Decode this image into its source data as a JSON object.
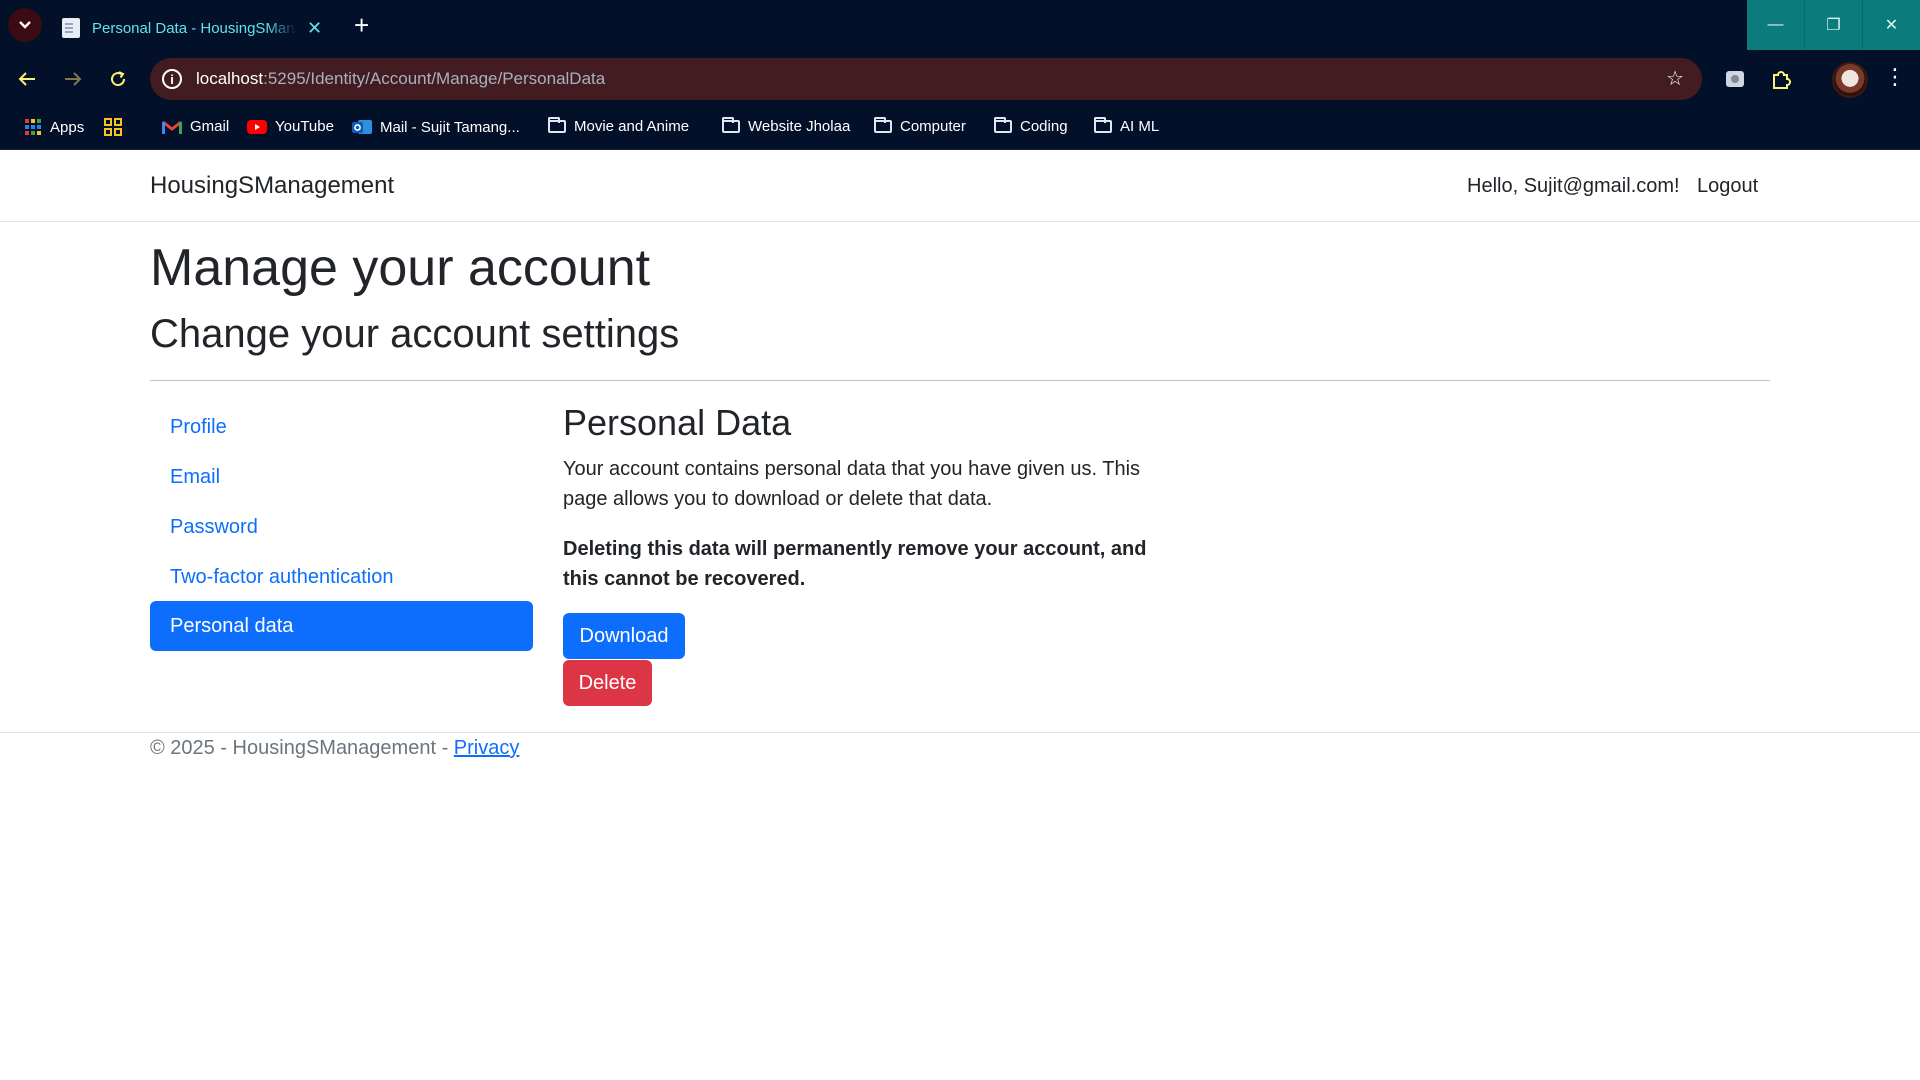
{
  "browser": {
    "tab": {
      "title": "Personal Data - HousingSManagement",
      "close_icon": "close-icon"
    },
    "url": {
      "host": "localhost",
      "path": ":5295/Identity/Account/Manage/PersonalData"
    },
    "bookmarks": [
      {
        "label": "Apps",
        "icon": "apps-grid-icon"
      },
      {
        "label": "",
        "icon": "tab-groups-icon"
      },
      {
        "label": "Gmail",
        "icon": "gmail-icon"
      },
      {
        "label": "YouTube",
        "icon": "youtube-icon"
      },
      {
        "label": "Mail - Sujit Tamang...",
        "icon": "outlook-icon"
      },
      {
        "label": "Movie and Anime",
        "icon": "folder-icon"
      },
      {
        "label": "Website Jholaa",
        "icon": "folder-icon"
      },
      {
        "label": "Computer",
        "icon": "folder-icon"
      },
      {
        "label": "Coding",
        "icon": "folder-icon"
      },
      {
        "label": "AI ML",
        "icon": "folder-icon"
      }
    ],
    "colors": {
      "chrome_bg": "#03102a",
      "omnibox_bg": "#421c20",
      "tab_text": "#5fe3f0",
      "window_controls": "#0b7b7b"
    }
  },
  "site": {
    "brand": "HousingSManagement",
    "greeting": "Hello, Sujit@gmail.com!",
    "logout": "Logout"
  },
  "page": {
    "heading": "Manage your account",
    "subheading": "Change your account settings",
    "sidebar": [
      {
        "label": "Profile",
        "active": false
      },
      {
        "label": "Email",
        "active": false
      },
      {
        "label": "Password",
        "active": false
      },
      {
        "label": "Two-factor authentication",
        "active": false
      },
      {
        "label": "Personal data",
        "active": true
      }
    ],
    "section_title": "Personal Data",
    "description": "Your account contains personal data that you have given us. This page allows you to download or delete that data.",
    "warning": "Deleting this data will permanently remove your account, and this cannot be recovered.",
    "download_label": "Download",
    "delete_label": "Delete"
  },
  "footer": {
    "text": "© 2025 - HousingSManagement - ",
    "privacy_link": "Privacy"
  },
  "colors": {
    "primary": "#0d6efd",
    "danger": "#dc3545",
    "text": "#212529",
    "muted": "#6c757d"
  }
}
